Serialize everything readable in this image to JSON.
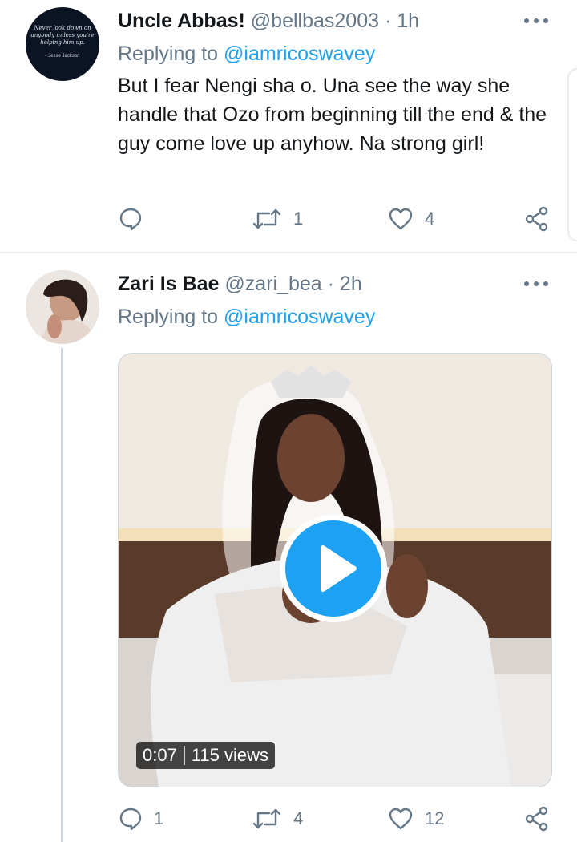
{
  "tweets": [
    {
      "name": "Uncle Abbas!",
      "handle": "@bellbas2003",
      "separator": "·",
      "time": "1h",
      "replying_prefix": "Replying to",
      "replying_to": "@iamricoswavey",
      "text": "But I fear Nengi sha o. Una see the way she handle that Ozo from beginning till the end & the guy come love up anyhow. Na strong girl!",
      "avatar": {
        "quote": "Never look down on anybody unless you're helping him up.",
        "author": "- Jesse Jackson"
      },
      "actions": {
        "reply": "",
        "retweet": "1",
        "like": "4"
      }
    },
    {
      "name": "Zari Is Bae",
      "handle": "@zari_bea",
      "separator": "·",
      "time": "2h",
      "replying_prefix": "Replying to",
      "replying_to": "@iamricoswavey",
      "media": {
        "duration": "0:07",
        "views": "115 views"
      },
      "actions": {
        "reply": "1",
        "retweet": "4",
        "like": "12"
      }
    }
  ],
  "colors": {
    "accent": "#1da1f2",
    "secondary_text": "#657786",
    "divider": "#e6ecf0"
  },
  "icons": [
    "more-icon",
    "reply-icon",
    "retweet-icon",
    "like-icon",
    "share-icon",
    "play-icon"
  ]
}
